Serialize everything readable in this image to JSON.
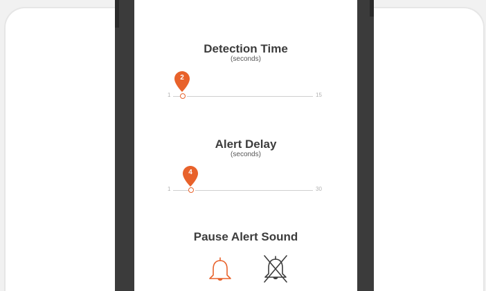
{
  "detection": {
    "title": "Detection Time",
    "unit": "(seconds)",
    "min": "1",
    "max": "15",
    "value": "2"
  },
  "alert_delay": {
    "title": "Alert Delay",
    "unit": "(seconds)",
    "min": "1",
    "max": "30",
    "value": "4"
  },
  "pause_sound": {
    "title": "Pause Alert Sound",
    "options": [
      "bell-icon",
      "bell-muted-icon"
    ],
    "selected": "bell-icon"
  },
  "colors": {
    "accent": "#e8622b",
    "title": "#3c3c3c",
    "frame": "#3b3b3b"
  }
}
